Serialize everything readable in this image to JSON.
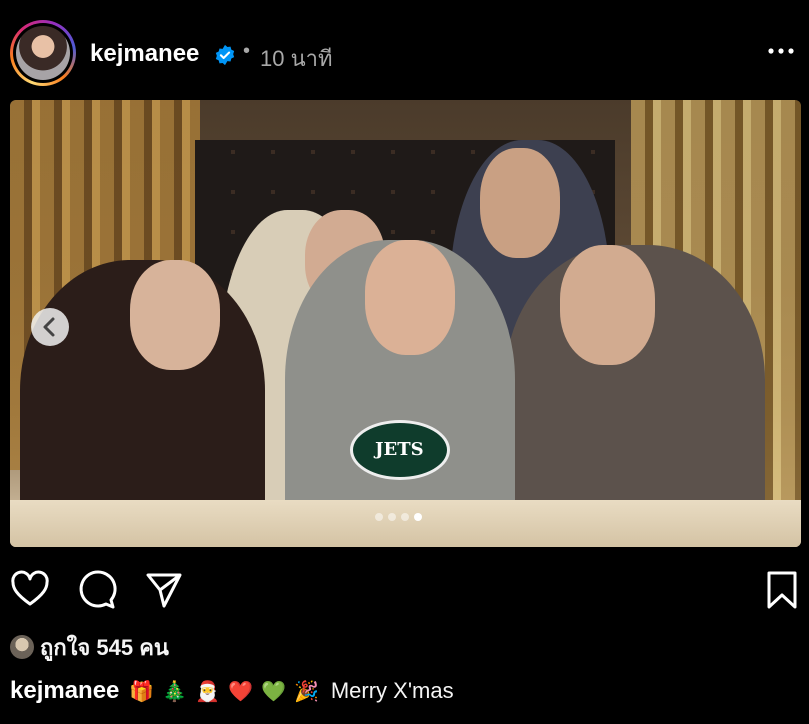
{
  "post": {
    "username": "kejmanee",
    "time_ago": "10 นาที",
    "separator": "•"
  },
  "photo": {
    "shirt_text": "JETS",
    "carousel": {
      "total": 4,
      "active_index": 3
    }
  },
  "likes": {
    "text": "ถูกใจ 545 คน"
  },
  "caption": {
    "username": "kejmanee",
    "emojis": [
      "🎁",
      "🎄",
      "🎅",
      "❤️",
      "💚",
      "🎉"
    ],
    "text": "Merry X'mas"
  },
  "colors": {
    "background": "#000000",
    "verified_blue": "#0095f6",
    "secondary_text": "#a8a8a8"
  },
  "icons": {
    "verified": "verified-badge-icon",
    "more": "more-options-icon",
    "like": "heart-icon",
    "comment": "comment-icon",
    "share": "send-icon",
    "save": "bookmark-icon",
    "prev": "chevron-left-icon"
  }
}
